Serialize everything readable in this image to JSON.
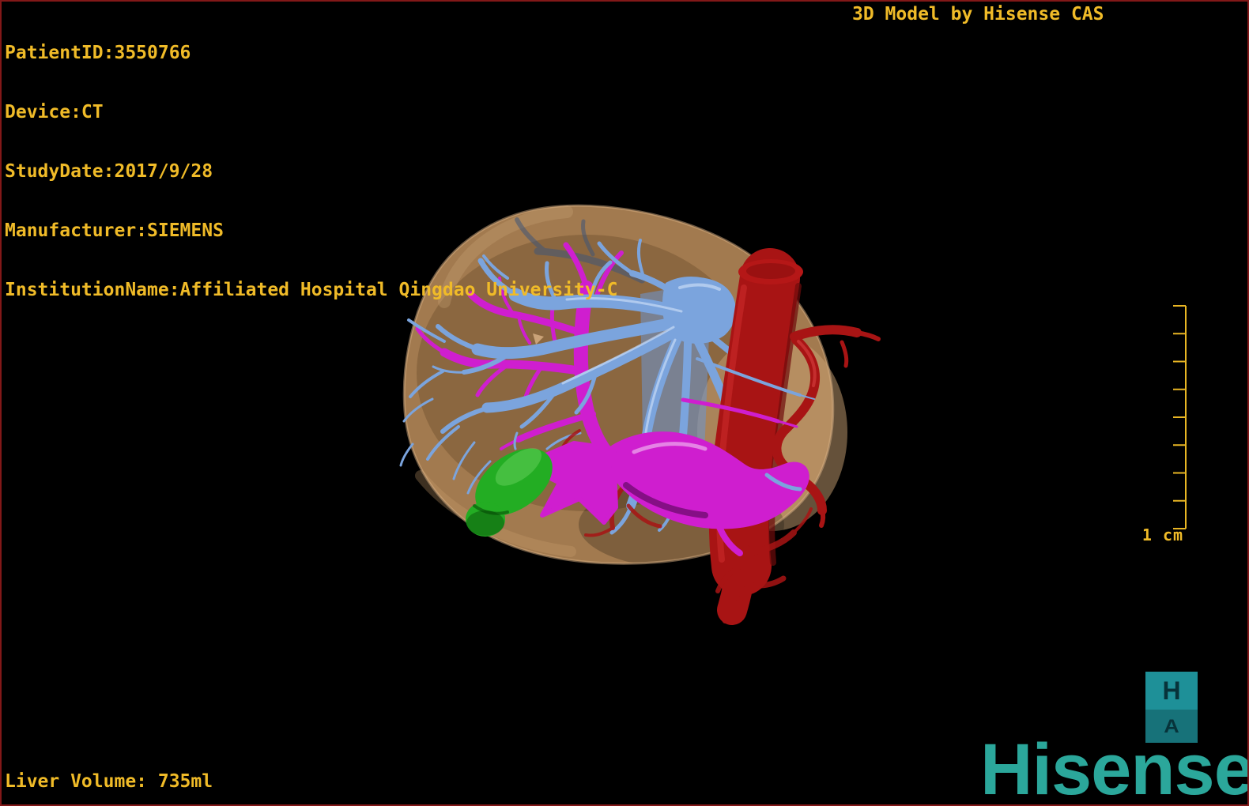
{
  "overlay": {
    "patient_info": {
      "patient_id": "PatientID:3550766",
      "device": "Device:CT",
      "study_date": "StudyDate:2017/9/28",
      "manufacturer": "Manufacturer:SIEMENS",
      "institution": "InstitutionName:Affiliated Hospital Qingdao University-C"
    },
    "watermark": "3D Model by Hisense CAS",
    "liver_volume": "Liver Volume: 735ml"
  },
  "ruler": {
    "label": "1 cm"
  },
  "orientation_cube": {
    "top_face": "H",
    "bottom_face": "A"
  },
  "logo": {
    "text": "Hisense"
  },
  "colors": {
    "overlay_text": "#f0bb28",
    "frame_border": "#821818",
    "ruler": "#e9b624",
    "logo": "#2ba79b",
    "cube_top": "#1e9098",
    "cube_bottom": "#177279",
    "cube_letter": "#07333a"
  },
  "model": {
    "structures": {
      "liver": "#a97f52",
      "portal_hepatic_veins": "#7ba4dd",
      "ivc": "#6f95cc",
      "hepatic_veins": "#cf1ecf",
      "arteries": "#a81414",
      "gallbladder": "#23ad23"
    }
  }
}
